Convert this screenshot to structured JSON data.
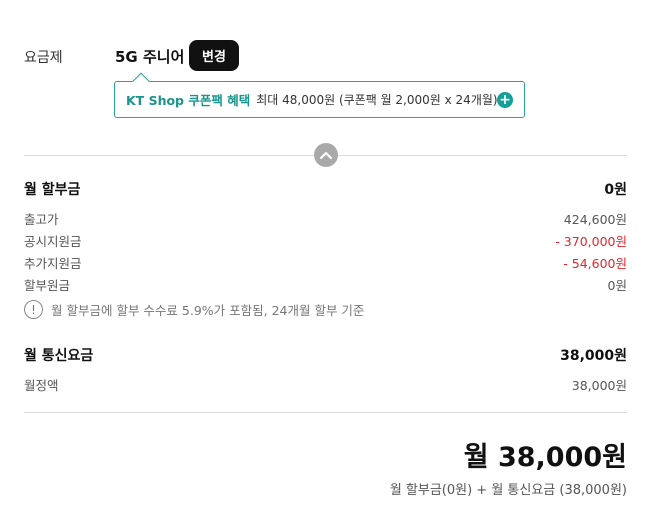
{
  "plan": {
    "label": "요금제",
    "name": "5G 주니어",
    "change_label": "변경"
  },
  "coupon": {
    "title": "KT Shop 쿠폰팩 혜택",
    "description": "최대 48,000원 (쿠폰팩 월 2,000원 x 24개월)",
    "icon": "plus-circle-icon",
    "accent_color": "#1a958d"
  },
  "installment": {
    "title": "월 할부금",
    "total": "0원",
    "items": [
      {
        "label": "출고가",
        "value": "424,600원"
      },
      {
        "label": "공시지원금",
        "value": "- 370,000원"
      },
      {
        "label": "추가지원금",
        "value": "- 54,600원"
      },
      {
        "label": "할부원금",
        "value": "0원"
      }
    ],
    "notice": "월 할부금에 할부 수수료 5.9%가 포함됨, 24개월 할부 기준",
    "negative_color": "#e8232b"
  },
  "communication": {
    "title": "월 통신요금",
    "total": "38,000원",
    "items": [
      {
        "label": "월정액",
        "value": "38,000원"
      }
    ]
  },
  "summary": {
    "total": "월 38,000원",
    "breakdown": "월 할부금(0원) + 월 통신요금 (38,000원)"
  }
}
